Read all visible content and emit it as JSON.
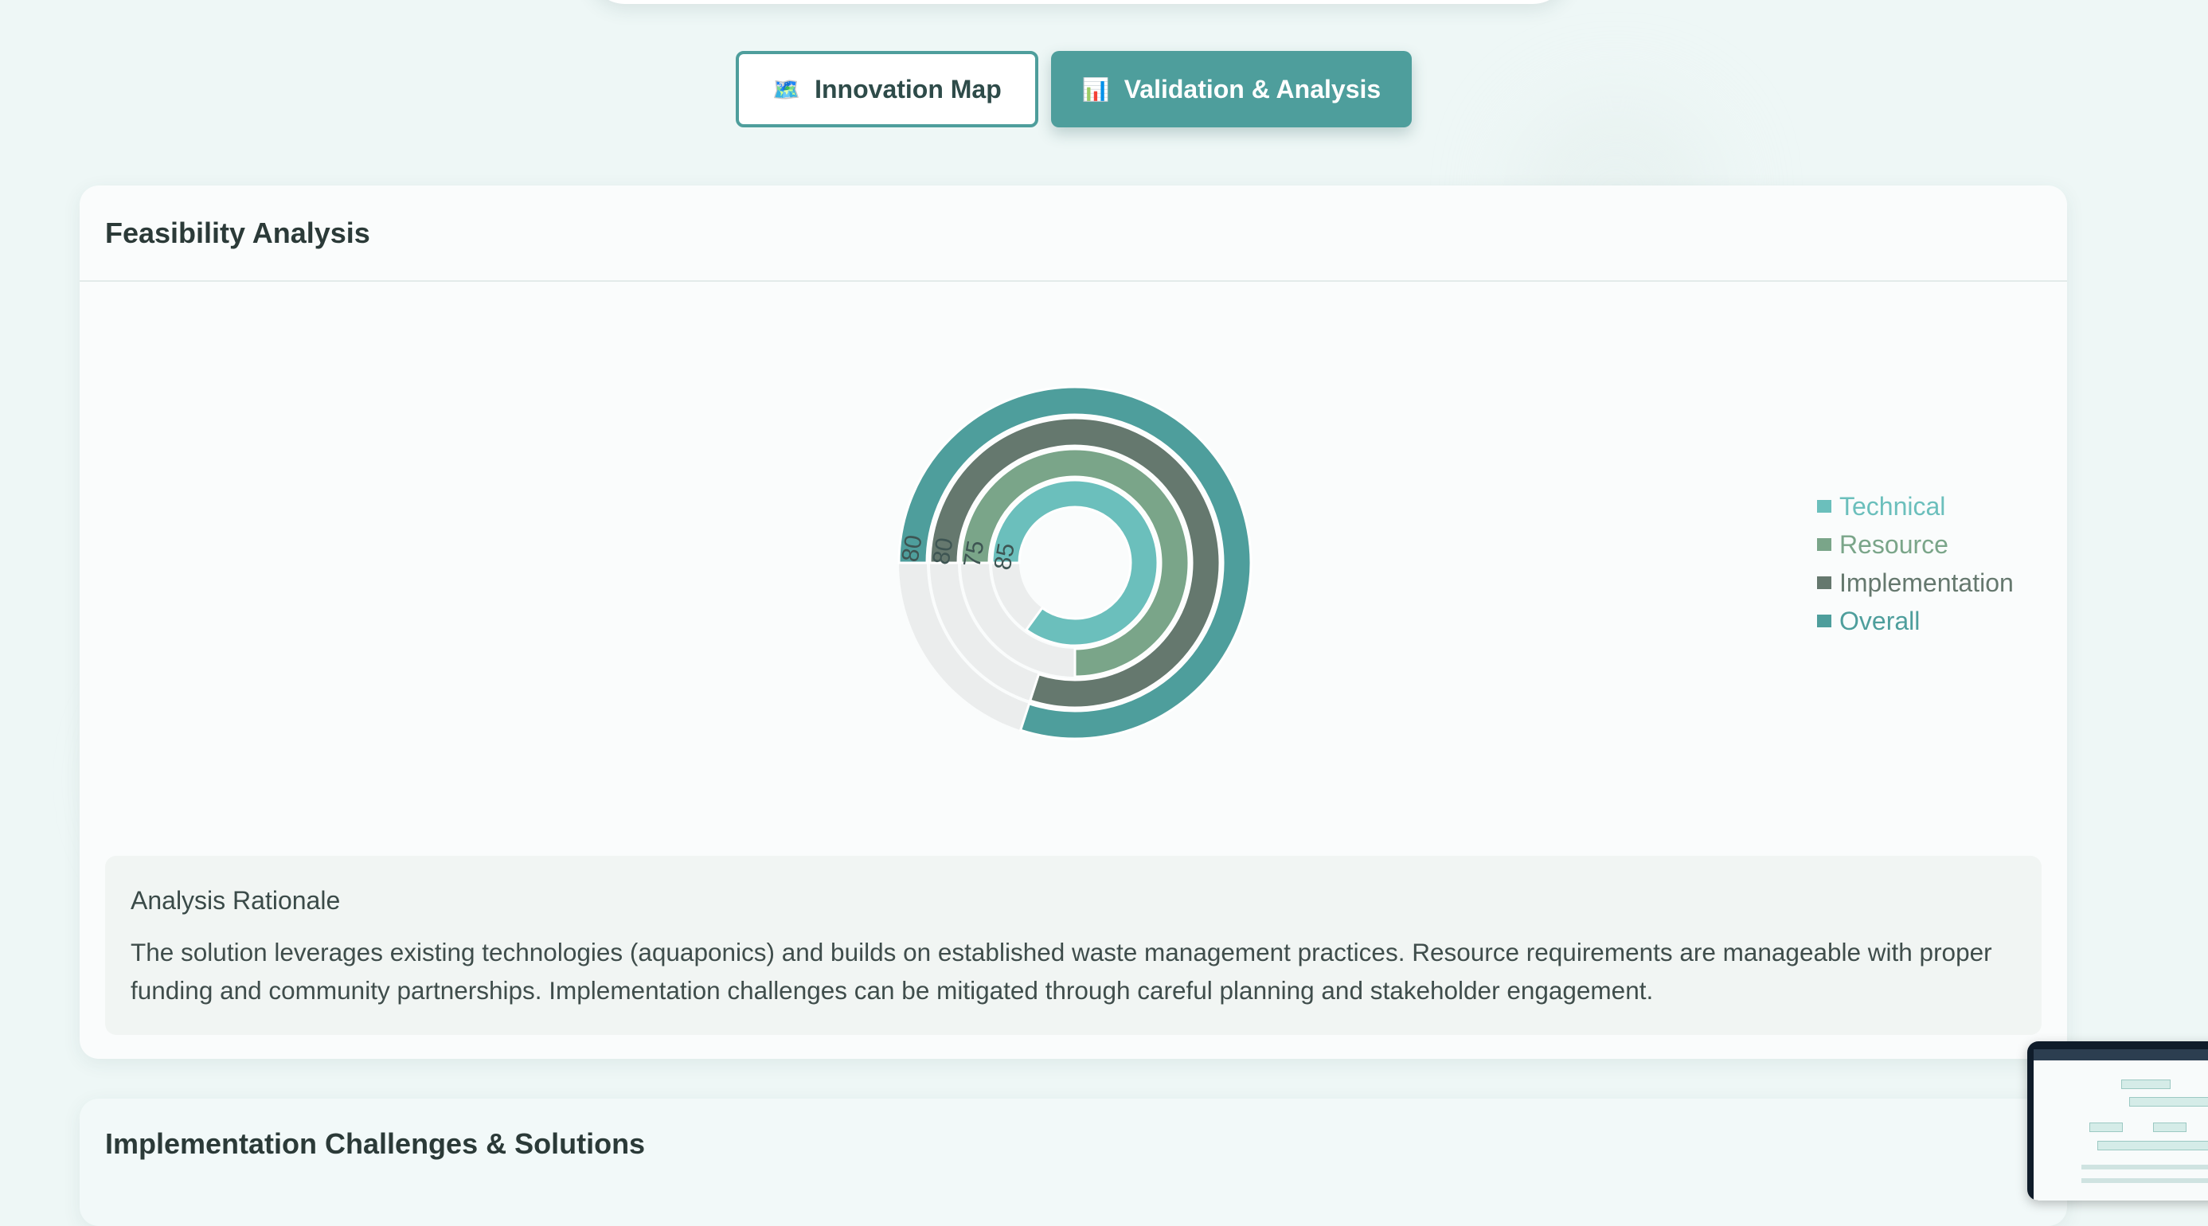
{
  "tabs": [
    {
      "label": "Innovation Map",
      "icon": "map-icon",
      "glyph": "🗺️",
      "active": false
    },
    {
      "label": "Validation & Analysis",
      "icon": "bar-chart-icon",
      "glyph": "📊",
      "active": true
    }
  ],
  "feasibility": {
    "title": "Feasibility Analysis",
    "rationale_title": "Analysis Rationale",
    "rationale_text": "The solution leverages existing technologies (aquaponics) and builds on established waste management practices. Resource requirements are manageable with proper funding and community partnerships. Implementation challenges can be mitigated through careful planning and stakeholder engagement."
  },
  "implementation": {
    "title": "Implementation Challenges & Solutions"
  },
  "chart_data": {
    "type": "radial-bar",
    "max": 100,
    "series": [
      {
        "name": "Technical",
        "value": 85,
        "color": "#6bbfbc"
      },
      {
        "name": "Resource",
        "value": 75,
        "color": "#7aa589"
      },
      {
        "name": "Implementation",
        "value": 80,
        "color": "#65786e"
      },
      {
        "name": "Overall",
        "value": 80,
        "color": "#4e9e9c"
      }
    ],
    "track_color": "#ebeded",
    "legend_position": "right"
  }
}
